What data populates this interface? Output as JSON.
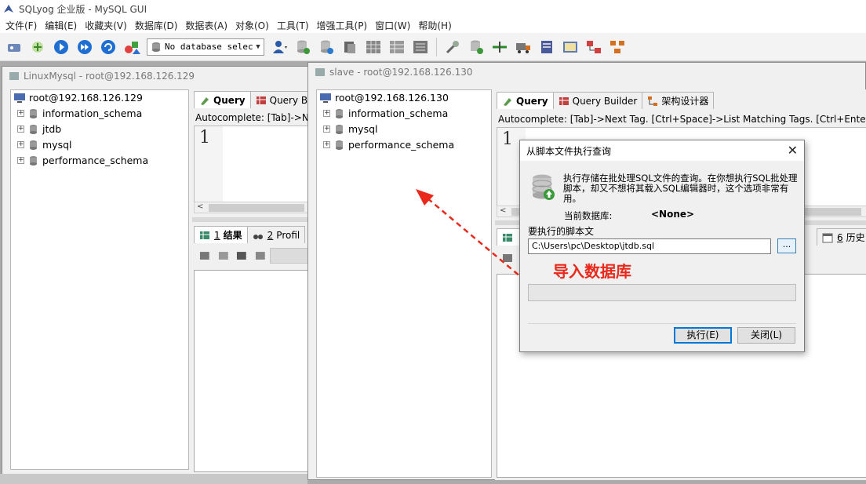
{
  "app": {
    "title": "SQLyog 企业版 - MySQL GUI"
  },
  "menu": [
    "文件(F)",
    "编辑(E)",
    "收藏夹(V)",
    "数据库(D)",
    "数据表(A)",
    "对象(O)",
    "工具(T)",
    "增强工具(P)",
    "窗口(W)",
    "帮助(H)"
  ],
  "toolbar": {
    "db_select_value": "No database select"
  },
  "window_left": {
    "title": "LinuxMysql - root@192.168.126.129",
    "tree": {
      "root": "root@192.168.126.129",
      "dbs": [
        "information_schema",
        "jtdb",
        "mysql",
        "performance_schema"
      ]
    },
    "tabs": {
      "query": "Query",
      "builder": "Query Bu"
    },
    "autocomplete": "Autocomplete: [Tab]->Ne",
    "line_number": "1",
    "result_tabs": {
      "results_num": "1",
      "results": "结果",
      "profile_num": "2",
      "profile": "Profil"
    }
  },
  "window_right": {
    "title": "slave - root@192.168.126.130",
    "tree": {
      "root": "root@192.168.126.130",
      "dbs": [
        "information_schema",
        "mysql",
        "performance_schema"
      ]
    },
    "tabs": {
      "query": "Query",
      "builder": "Query Builder",
      "schema": "架构设计器"
    },
    "autocomplete": "Autocomplete: [Tab]->Next Tag. [Ctrl+Space]->List Matching Tags. [Ctrl+Enter]->List All Tags.",
    "line_number": "1",
    "result_tabs": {
      "history_num": "6",
      "history": "历史"
    }
  },
  "dialog": {
    "title": "从脚本文件执行查询",
    "description": "执行存储在批处理SQL文件的查询。在你想执行SQL批处理脚本，却又不想将其载入SQL编辑器时，这个选项非常有用。",
    "current_db_label": "当前数据库:",
    "current_db_value": "<None>",
    "script_label": "要执行的脚本文",
    "script_path": "C:\\Users\\pc\\Desktop\\jtdb.sql",
    "browse_label": "...",
    "execute_label": "执行(E)",
    "close_label": "关闭(L)"
  },
  "annotation": {
    "text": "导入数据库",
    "color": "#e8291c"
  }
}
